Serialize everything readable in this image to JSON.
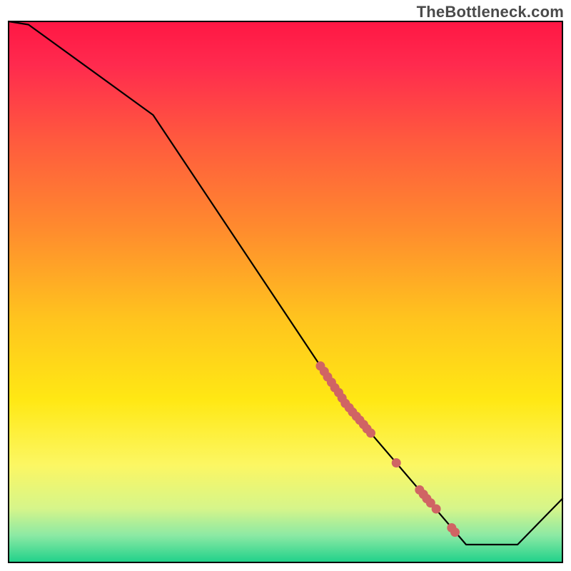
{
  "watermark": "TheBottleneck.com",
  "chart_data": {
    "type": "line",
    "title": "",
    "xlabel": "",
    "ylabel": "",
    "xlim": [
      0,
      100
    ],
    "ylim": [
      0,
      100
    ],
    "grid": false,
    "legend": false,
    "line": {
      "name": "curve",
      "x": [
        0,
        3.6,
        26.1,
        60.8,
        82.6,
        91.9,
        100
      ],
      "y": [
        100,
        99.4,
        82.7,
        29.4,
        3.3,
        3.3,
        11.8
      ]
    },
    "highlight_dots": {
      "color": "#d06464",
      "points": [
        {
          "x": 56.3,
          "y": 36.3
        },
        {
          "x": 57.0,
          "y": 35.3
        },
        {
          "x": 57.6,
          "y": 34.3
        },
        {
          "x": 58.3,
          "y": 33.3
        },
        {
          "x": 58.9,
          "y": 32.3
        },
        {
          "x": 59.6,
          "y": 31.4
        },
        {
          "x": 60.2,
          "y": 30.4
        },
        {
          "x": 60.8,
          "y": 29.4
        },
        {
          "x": 61.5,
          "y": 28.6
        },
        {
          "x": 62.1,
          "y": 27.8
        },
        {
          "x": 62.8,
          "y": 27.0
        },
        {
          "x": 63.4,
          "y": 26.3
        },
        {
          "x": 64.1,
          "y": 25.5
        },
        {
          "x": 64.7,
          "y": 24.7
        },
        {
          "x": 65.4,
          "y": 23.9
        },
        {
          "x": 70.0,
          "y": 18.4
        },
        {
          "x": 74.2,
          "y": 13.4
        },
        {
          "x": 74.9,
          "y": 12.6
        },
        {
          "x": 75.5,
          "y": 11.8
        },
        {
          "x": 76.2,
          "y": 11.0
        },
        {
          "x": 77.2,
          "y": 9.9
        },
        {
          "x": 80.0,
          "y": 6.4
        },
        {
          "x": 80.6,
          "y": 5.6
        }
      ]
    }
  }
}
